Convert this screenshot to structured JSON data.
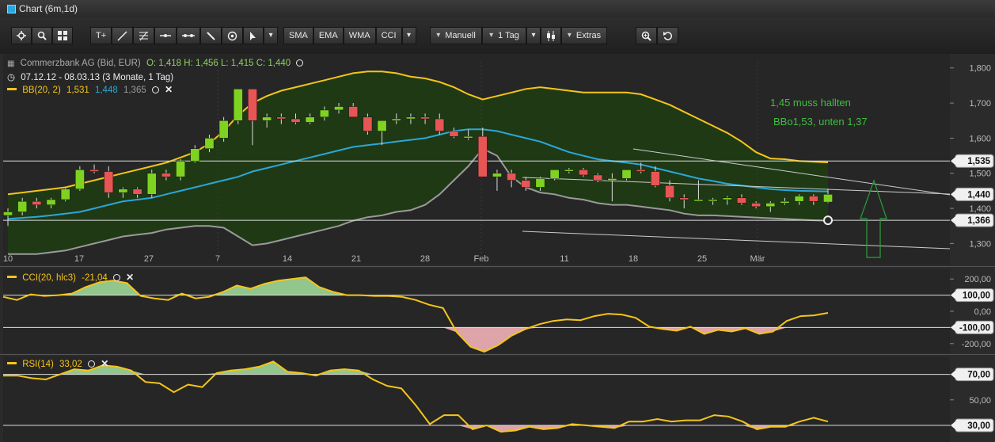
{
  "window": {
    "title": "Chart (6m,1d)"
  },
  "toolbar": {
    "indicators": [
      "SMA",
      "EMA",
      "WMA",
      "CCI"
    ],
    "mode": "Manuell",
    "period": "1 Tag",
    "extras": "Extras"
  },
  "legend": {
    "instrument": "Commerzbank AG (Bid, EUR)",
    "ohlc": "O: 1,418  H: 1,456  L: 1,415  C: 1,440",
    "range": "07.12.12 - 08.03.13 (3 Monate, 1 Tag)",
    "bb_name": "BB(20, 2)",
    "bb_upper": "1,531",
    "bb_mid": "1,448",
    "bb_lower": "1,365",
    "cci_name": "CCI(20, hlc3)",
    "cci_value": "-21,04",
    "rsi_name": "RSI(14)",
    "rsi_value": "33,02"
  },
  "annotations": {
    "line1": "1,45  muss hallten",
    "line2": "BBo1,53, unten 1,37"
  },
  "colors": {
    "up": "#7ed321",
    "down": "#e85555",
    "bb_outer": "#f5c518",
    "bb_mid": "#2aa7d8",
    "bb_lower": "#9a9a9a",
    "fill": "#1f3a14"
  },
  "chart_data": [
    {
      "type": "candlestick",
      "title": "Commerzbank AG (Bid, EUR)",
      "x_ticks": [
        "10",
        "17",
        "27",
        "7",
        "14",
        "21",
        "28",
        "Feb",
        "11",
        "18",
        "25",
        "Mär"
      ],
      "y_ticks": [
        "1,800",
        "1,700",
        "1,600",
        "1,500",
        "1,400",
        "1,300"
      ],
      "ylim": [
        1.24,
        1.84
      ],
      "horizontal_levels": [
        {
          "value": 1.535,
          "label": "1,535"
        },
        {
          "value": 1.366,
          "label": "1,366"
        }
      ],
      "last_price": {
        "value": 1.44,
        "label": "1,440"
      },
      "candles": [
        {
          "o": 1.38,
          "h": 1.4,
          "l": 1.35,
          "c": 1.39
        },
        {
          "o": 1.39,
          "h": 1.43,
          "l": 1.38,
          "c": 1.42
        },
        {
          "o": 1.42,
          "h": 1.43,
          "l": 1.4,
          "c": 1.41
        },
        {
          "o": 1.41,
          "h": 1.43,
          "l": 1.4,
          "c": 1.425
        },
        {
          "o": 1.425,
          "h": 1.46,
          "l": 1.42,
          "c": 1.455
        },
        {
          "o": 1.455,
          "h": 1.52,
          "l": 1.45,
          "c": 1.51
        },
        {
          "o": 1.51,
          "h": 1.525,
          "l": 1.5,
          "c": 1.505
        },
        {
          "o": 1.505,
          "h": 1.52,
          "l": 1.43,
          "c": 1.445
        },
        {
          "o": 1.445,
          "h": 1.46,
          "l": 1.43,
          "c": 1.455
        },
        {
          "o": 1.455,
          "h": 1.46,
          "l": 1.43,
          "c": 1.44
        },
        {
          "o": 1.44,
          "h": 1.51,
          "l": 1.43,
          "c": 1.5
        },
        {
          "o": 1.5,
          "h": 1.51,
          "l": 1.48,
          "c": 1.49
        },
        {
          "o": 1.49,
          "h": 1.54,
          "l": 1.48,
          "c": 1.535
        },
        {
          "o": 1.535,
          "h": 1.58,
          "l": 1.53,
          "c": 1.57
        },
        {
          "o": 1.57,
          "h": 1.61,
          "l": 1.56,
          "c": 1.6
        },
        {
          "o": 1.6,
          "h": 1.66,
          "l": 1.59,
          "c": 1.65
        },
        {
          "o": 1.65,
          "h": 1.74,
          "l": 1.64,
          "c": 1.74
        },
        {
          "o": 1.74,
          "h": 1.74,
          "l": 1.58,
          "c": 1.65
        },
        {
          "o": 1.65,
          "h": 1.67,
          "l": 1.63,
          "c": 1.66
        },
        {
          "o": 1.66,
          "h": 1.67,
          "l": 1.64,
          "c": 1.655
        },
        {
          "o": 1.655,
          "h": 1.67,
          "l": 1.64,
          "c": 1.645
        },
        {
          "o": 1.645,
          "h": 1.67,
          "l": 1.64,
          "c": 1.66
        },
        {
          "o": 1.66,
          "h": 1.69,
          "l": 1.65,
          "c": 1.68
        },
        {
          "o": 1.68,
          "h": 1.7,
          "l": 1.67,
          "c": 1.69
        },
        {
          "o": 1.69,
          "h": 1.7,
          "l": 1.66,
          "c": 1.66
        },
        {
          "o": 1.66,
          "h": 1.67,
          "l": 1.61,
          "c": 1.62
        },
        {
          "o": 1.62,
          "h": 1.65,
          "l": 1.58,
          "c": 1.65
        },
        {
          "o": 1.65,
          "h": 1.67,
          "l": 1.64,
          "c": 1.655
        },
        {
          "o": 1.655,
          "h": 1.67,
          "l": 1.64,
          "c": 1.66
        },
        {
          "o": 1.66,
          "h": 1.67,
          "l": 1.64,
          "c": 1.655
        },
        {
          "o": 1.655,
          "h": 1.67,
          "l": 1.61,
          "c": 1.62
        },
        {
          "o": 1.62,
          "h": 1.63,
          "l": 1.6,
          "c": 1.605
        },
        {
          "o": 1.605,
          "h": 1.625,
          "l": 1.595,
          "c": 1.605
        },
        {
          "o": 1.605,
          "h": 1.63,
          "l": 1.49,
          "c": 1.49
        },
        {
          "o": 1.49,
          "h": 1.51,
          "l": 1.45,
          "c": 1.5
        },
        {
          "o": 1.5,
          "h": 1.51,
          "l": 1.46,
          "c": 1.48
        },
        {
          "o": 1.48,
          "h": 1.49,
          "l": 1.45,
          "c": 1.46
        },
        {
          "o": 1.46,
          "h": 1.49,
          "l": 1.45,
          "c": 1.485
        },
        {
          "o": 1.485,
          "h": 1.51,
          "l": 1.48,
          "c": 1.51
        },
        {
          "o": 1.51,
          "h": 1.515,
          "l": 1.5,
          "c": 1.51
        },
        {
          "o": 1.51,
          "h": 1.515,
          "l": 1.49,
          "c": 1.495
        },
        {
          "o": 1.495,
          "h": 1.5,
          "l": 1.475,
          "c": 1.48
        },
        {
          "o": 1.48,
          "h": 1.5,
          "l": 1.42,
          "c": 1.485
        },
        {
          "o": 1.485,
          "h": 1.51,
          "l": 1.48,
          "c": 1.51
        },
        {
          "o": 1.51,
          "h": 1.53,
          "l": 1.5,
          "c": 1.505
        },
        {
          "o": 1.505,
          "h": 1.52,
          "l": 1.46,
          "c": 1.465
        },
        {
          "o": 1.465,
          "h": 1.48,
          "l": 1.42,
          "c": 1.43
        },
        {
          "o": 1.43,
          "h": 1.44,
          "l": 1.4,
          "c": 1.425
        },
        {
          "o": 1.425,
          "h": 1.48,
          "l": 1.42,
          "c": 1.425
        },
        {
          "o": 1.425,
          "h": 1.43,
          "l": 1.41,
          "c": 1.425
        },
        {
          "o": 1.425,
          "h": 1.435,
          "l": 1.41,
          "c": 1.43
        },
        {
          "o": 1.43,
          "h": 1.44,
          "l": 1.41,
          "c": 1.415
        },
        {
          "o": 1.415,
          "h": 1.42,
          "l": 1.4,
          "c": 1.405
        },
        {
          "o": 1.405,
          "h": 1.42,
          "l": 1.39,
          "c": 1.415
        },
        {
          "o": 1.415,
          "h": 1.43,
          "l": 1.41,
          "c": 1.42
        },
        {
          "o": 1.42,
          "h": 1.44,
          "l": 1.41,
          "c": 1.435
        },
        {
          "o": 1.435,
          "h": 1.44,
          "l": 1.41,
          "c": 1.42
        },
        {
          "o": 1.418,
          "h": 1.456,
          "l": 1.415,
          "c": 1.44
        }
      ],
      "bb_upper": [
        1.44,
        1.445,
        1.45,
        1.455,
        1.46,
        1.47,
        1.48,
        1.49,
        1.5,
        1.51,
        1.52,
        1.53,
        1.545,
        1.56,
        1.585,
        1.62,
        1.665,
        1.7,
        1.72,
        1.735,
        1.745,
        1.755,
        1.765,
        1.775,
        1.785,
        1.79,
        1.79,
        1.785,
        1.775,
        1.77,
        1.76,
        1.745,
        1.725,
        1.71,
        1.72,
        1.73,
        1.74,
        1.745,
        1.74,
        1.735,
        1.73,
        1.73,
        1.73,
        1.73,
        1.725,
        1.71,
        1.695,
        1.675,
        1.655,
        1.635,
        1.615,
        1.59,
        1.56,
        1.542,
        1.54,
        1.535,
        1.533,
        1.531
      ],
      "bb_mid": [
        1.37,
        1.373,
        1.376,
        1.38,
        1.385,
        1.39,
        1.4,
        1.41,
        1.42,
        1.425,
        1.43,
        1.44,
        1.45,
        1.46,
        1.47,
        1.48,
        1.49,
        1.505,
        1.515,
        1.525,
        1.535,
        1.545,
        1.555,
        1.565,
        1.575,
        1.58,
        1.585,
        1.59,
        1.595,
        1.6,
        1.61,
        1.62,
        1.625,
        1.625,
        1.62,
        1.61,
        1.6,
        1.59,
        1.575,
        1.56,
        1.55,
        1.54,
        1.535,
        1.53,
        1.525,
        1.515,
        1.505,
        1.495,
        1.485,
        1.478,
        1.47,
        1.465,
        1.46,
        1.455,
        1.452,
        1.45,
        1.449,
        1.448
      ],
      "bb_lower": [
        1.27,
        1.27,
        1.27,
        1.275,
        1.28,
        1.29,
        1.3,
        1.31,
        1.32,
        1.325,
        1.33,
        1.34,
        1.345,
        1.35,
        1.35,
        1.345,
        1.32,
        1.295,
        1.3,
        1.31,
        1.32,
        1.33,
        1.34,
        1.35,
        1.365,
        1.375,
        1.38,
        1.39,
        1.395,
        1.41,
        1.44,
        1.48,
        1.52,
        1.57,
        1.55,
        1.49,
        1.46,
        1.445,
        1.44,
        1.43,
        1.425,
        1.415,
        1.41,
        1.41,
        1.405,
        1.4,
        1.395,
        1.385,
        1.38,
        1.38,
        1.378,
        1.376,
        1.374,
        1.372,
        1.37,
        1.368,
        1.366,
        1.365
      ]
    },
    {
      "type": "line",
      "title": "CCI(20, hlc3)",
      "y_ticks": [
        "200,00",
        "100,00",
        "0,00",
        "-100,00",
        "-200,00"
      ],
      "ylim": [
        -260,
        260
      ],
      "reference_levels": [
        100,
        -100
      ],
      "values": [
        90,
        70,
        105,
        95,
        100,
        110,
        150,
        180,
        190,
        175,
        95,
        80,
        70,
        110,
        80,
        90,
        120,
        160,
        140,
        170,
        190,
        200,
        210,
        150,
        120,
        100,
        100,
        95,
        95,
        90,
        70,
        40,
        20,
        -130,
        -220,
        -250,
        -210,
        -150,
        -110,
        -80,
        -60,
        -50,
        -55,
        -30,
        -15,
        -20,
        -40,
        -95,
        -110,
        -120,
        -95,
        -140,
        -115,
        -125,
        -105,
        -140,
        -125,
        -60,
        -30,
        -25,
        -10
      ]
    },
    {
      "type": "line",
      "title": "RSI(14)",
      "y_ticks": [
        "70,00",
        "50,00",
        "30,00"
      ],
      "ylim": [
        17,
        84
      ],
      "reference_levels": [
        70,
        30
      ],
      "values": [
        69,
        69,
        67,
        66,
        70,
        74,
        73,
        77,
        76,
        73,
        64,
        63,
        56,
        62,
        60,
        71,
        73,
        74,
        76,
        80,
        72,
        71,
        69,
        73,
        74,
        73,
        66,
        61,
        59,
        46,
        31,
        38,
        38,
        27,
        30,
        25,
        26,
        29,
        27,
        28,
        31,
        30,
        29,
        28,
        33,
        33,
        35,
        33,
        34,
        34,
        38,
        37,
        33,
        27,
        29,
        29,
        33,
        36,
        33
      ]
    }
  ]
}
